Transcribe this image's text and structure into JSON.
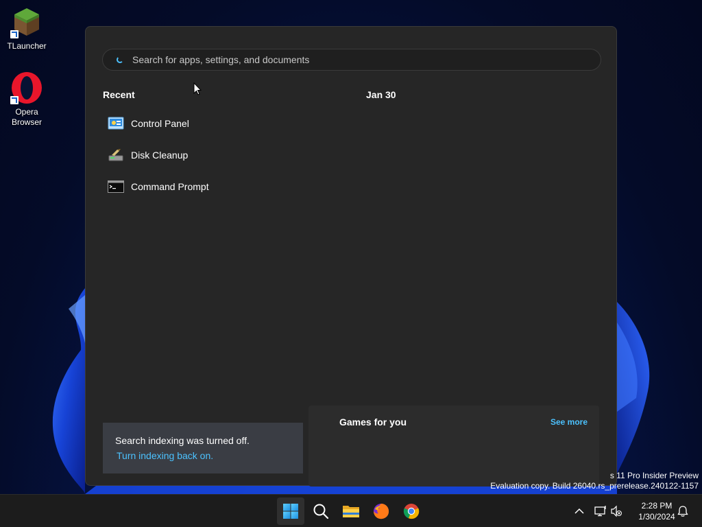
{
  "desktop": {
    "icons": [
      {
        "label": "TLauncher",
        "icon": "minecraft-grass-block-icon"
      },
      {
        "label": "Opera\nBrowser",
        "icon": "opera-logo-icon"
      }
    ]
  },
  "search": {
    "placeholder": "Search for apps, settings, and documents",
    "value": ""
  },
  "recent": {
    "heading": "Recent",
    "items": [
      {
        "label": "Control Panel",
        "icon": "control-panel-icon"
      },
      {
        "label": "Disk Cleanup",
        "icon": "disk-cleanup-icon"
      },
      {
        "label": "Command Prompt",
        "icon": "command-prompt-icon"
      }
    ]
  },
  "today": {
    "heading": "Jan 30"
  },
  "indexing_notice": {
    "message": "Search indexing was turned off.",
    "link": "Turn indexing back on."
  },
  "games": {
    "title": "Games for you",
    "see_more": "See more"
  },
  "watermark": {
    "line1": "s 11 Pro Insider Preview",
    "line2": "Evaluation copy. Build 26040.rs_prerelease.240122-1157"
  },
  "taskbar": {
    "apps": [
      {
        "name": "start",
        "icon": "windows-start-icon",
        "active": true
      },
      {
        "name": "search",
        "icon": "search-icon",
        "active": false
      },
      {
        "name": "file-explorer",
        "icon": "folder-icon",
        "active": false
      },
      {
        "name": "firefox",
        "icon": "firefox-icon",
        "active": false
      },
      {
        "name": "chrome",
        "icon": "chrome-icon",
        "active": false
      }
    ],
    "clock": {
      "time": "2:28 PM",
      "date": "1/30/2024"
    }
  },
  "colors": {
    "accent": "#4cc2ff",
    "flyout_bg": "#262626",
    "taskbar_bg": "#1c1c1c",
    "notice_bg": "#3a3d44"
  }
}
